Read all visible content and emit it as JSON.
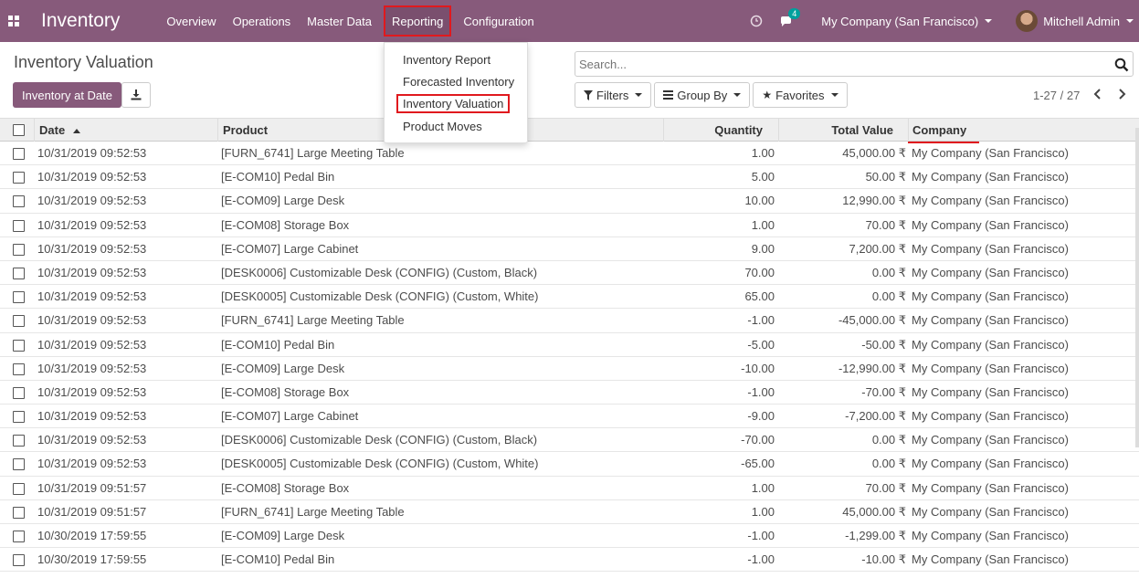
{
  "app": {
    "title": "Inventory"
  },
  "nav": {
    "items": [
      {
        "label": "Overview"
      },
      {
        "label": "Operations"
      },
      {
        "label": "Master Data"
      },
      {
        "label": "Reporting"
      },
      {
        "label": "Configuration"
      }
    ],
    "chat_count": "4",
    "company": "My Company (San Francisco)",
    "user": "Mitchell Admin"
  },
  "reporting_menu": {
    "items": [
      {
        "label": "Inventory Report"
      },
      {
        "label": "Forecasted Inventory"
      },
      {
        "label": "Inventory Valuation"
      },
      {
        "label": "Product Moves"
      }
    ]
  },
  "page": {
    "title": "Inventory Valuation",
    "primary_button": "Inventory at Date",
    "search_placeholder": "Search...",
    "filters_label": "Filters",
    "groupby_label": "Group By",
    "favorites_label": "Favorites",
    "pager": "1-27 / 27"
  },
  "table": {
    "headers": {
      "date": "Date",
      "product": "Product",
      "quantity": "Quantity",
      "total_value": "Total Value",
      "company": "Company"
    },
    "rows": [
      {
        "date": "10/31/2019 09:52:53",
        "product": "[FURN_6741] Large Meeting Table",
        "quantity": "1.00",
        "value": "45,000.00 ₹",
        "company": "My Company (San Francisco)"
      },
      {
        "date": "10/31/2019 09:52:53",
        "product": "[E-COM10] Pedal Bin",
        "quantity": "5.00",
        "value": "50.00 ₹",
        "company": "My Company (San Francisco)"
      },
      {
        "date": "10/31/2019 09:52:53",
        "product": "[E-COM09] Large Desk",
        "quantity": "10.00",
        "value": "12,990.00 ₹",
        "company": "My Company (San Francisco)"
      },
      {
        "date": "10/31/2019 09:52:53",
        "product": "[E-COM08] Storage Box",
        "quantity": "1.00",
        "value": "70.00 ₹",
        "company": "My Company (San Francisco)"
      },
      {
        "date": "10/31/2019 09:52:53",
        "product": "[E-COM07] Large Cabinet",
        "quantity": "9.00",
        "value": "7,200.00 ₹",
        "company": "My Company (San Francisco)"
      },
      {
        "date": "10/31/2019 09:52:53",
        "product": "[DESK0006] Customizable Desk (CONFIG) (Custom, Black)",
        "quantity": "70.00",
        "value": "0.00 ₹",
        "company": "My Company (San Francisco)"
      },
      {
        "date": "10/31/2019 09:52:53",
        "product": "[DESK0005] Customizable Desk (CONFIG) (Custom, White)",
        "quantity": "65.00",
        "value": "0.00 ₹",
        "company": "My Company (San Francisco)"
      },
      {
        "date": "10/31/2019 09:52:53",
        "product": "[FURN_6741] Large Meeting Table",
        "quantity": "-1.00",
        "value": "-45,000.00 ₹",
        "company": "My Company (San Francisco)"
      },
      {
        "date": "10/31/2019 09:52:53",
        "product": "[E-COM10] Pedal Bin",
        "quantity": "-5.00",
        "value": "-50.00 ₹",
        "company": "My Company (San Francisco)"
      },
      {
        "date": "10/31/2019 09:52:53",
        "product": "[E-COM09] Large Desk",
        "quantity": "-10.00",
        "value": "-12,990.00 ₹",
        "company": "My Company (San Francisco)"
      },
      {
        "date": "10/31/2019 09:52:53",
        "product": "[E-COM08] Storage Box",
        "quantity": "-1.00",
        "value": "-70.00 ₹",
        "company": "My Company (San Francisco)"
      },
      {
        "date": "10/31/2019 09:52:53",
        "product": "[E-COM07] Large Cabinet",
        "quantity": "-9.00",
        "value": "-7,200.00 ₹",
        "company": "My Company (San Francisco)"
      },
      {
        "date": "10/31/2019 09:52:53",
        "product": "[DESK0006] Customizable Desk (CONFIG) (Custom, Black)",
        "quantity": "-70.00",
        "value": "0.00 ₹",
        "company": "My Company (San Francisco)"
      },
      {
        "date": "10/31/2019 09:52:53",
        "product": "[DESK0005] Customizable Desk (CONFIG) (Custom, White)",
        "quantity": "-65.00",
        "value": "0.00 ₹",
        "company": "My Company (San Francisco)"
      },
      {
        "date": "10/31/2019 09:51:57",
        "product": "[E-COM08] Storage Box",
        "quantity": "1.00",
        "value": "70.00 ₹",
        "company": "My Company (San Francisco)"
      },
      {
        "date": "10/31/2019 09:51:57",
        "product": "[FURN_6741] Large Meeting Table",
        "quantity": "1.00",
        "value": "45,000.00 ₹",
        "company": "My Company (San Francisco)"
      },
      {
        "date": "10/30/2019 17:59:55",
        "product": "[E-COM09] Large Desk",
        "quantity": "-1.00",
        "value": "-1,299.00 ₹",
        "company": "My Company (San Francisco)"
      },
      {
        "date": "10/30/2019 17:59:55",
        "product": "[E-COM10] Pedal Bin",
        "quantity": "-1.00",
        "value": "-10.00 ₹",
        "company": "My Company (San Francisco)"
      }
    ]
  },
  "colors": {
    "brand": "#875a7b",
    "highlight": "#e0191e",
    "badge": "#00a09d"
  }
}
